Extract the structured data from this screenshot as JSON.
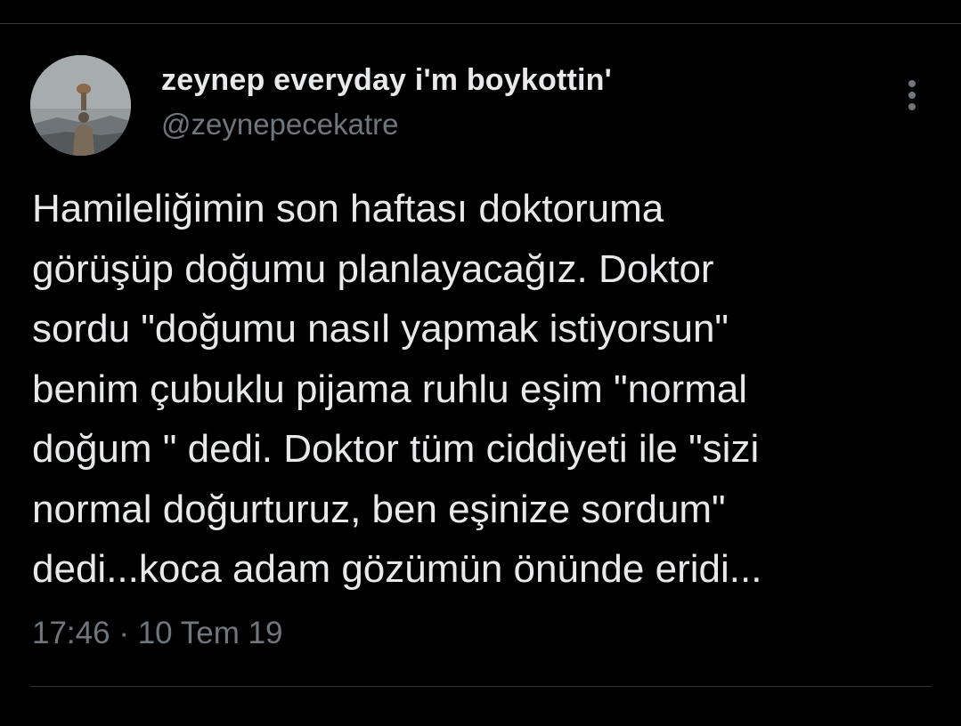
{
  "tweet": {
    "author": {
      "display_name": "zeynep everyday i'm boykottin'",
      "handle": "@zeynepecekatre",
      "avatar_icon": "profile-photo"
    },
    "more_icon": "more-vertical-dots-icon",
    "text_lines": [
      "Hamileliğimin son haftası doktoruma",
      "görüşüp doğumu planlayacağız. Doktor",
      "sordu \"doğumu nasıl yapmak istiyorsun\"",
      "benim çubuklu pijama ruhlu eşim \"normal",
      "doğum \" dedi. Doktor tüm ciddiyeti ile \"sizi",
      "normal doğurturuz, ben eşinize sordum\"",
      "dedi...koca adam gözümün önünde eridi..."
    ],
    "time": "17:46",
    "separator": " · ",
    "date": "10 Tem 19"
  },
  "colors": {
    "background": "#000000",
    "primary_text": "#e7e9ea",
    "secondary_text": "#71767b",
    "divider": "#2f3336"
  }
}
